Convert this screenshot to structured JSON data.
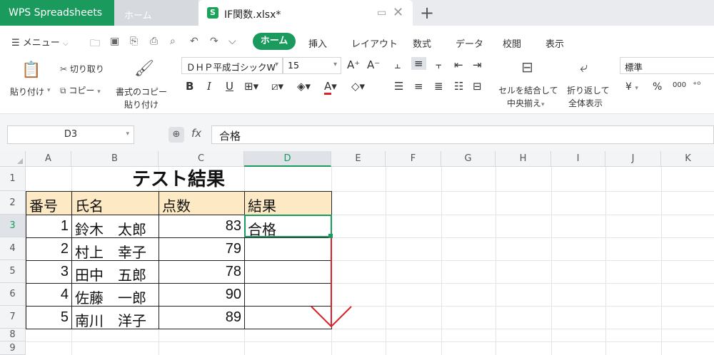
{
  "titlebar": {
    "app_tab": "WPS Spreadsheets",
    "home_tab": "ホーム",
    "file_tab": "IF関数.xlsx*",
    "file_icon": "S",
    "add_tab": "+"
  },
  "ribbon": {
    "menu_label": "メニュー",
    "tabs": [
      "ホーム",
      "挿入",
      "レイアウト",
      "数式",
      "データ",
      "校閲",
      "表示"
    ],
    "paste": "貼り付け",
    "cut": "切り取り",
    "copy": "コピー",
    "format_painter_line1": "書式のコピー",
    "format_painter_line2": "貼り付け",
    "font_name": "ＤＨＰ平成ゴシックW",
    "font_size": "15",
    "bold": "B",
    "italic": "I",
    "underline": "U",
    "merge_line1": "セルを結合して",
    "merge_line2": "中央揃え",
    "wrap_line1": "折り返して",
    "wrap_line2": "全体表示",
    "number_format": "標準",
    "currency": "¥",
    "percent": "%",
    "thousands": "000"
  },
  "formula_bar": {
    "name_box": "D3",
    "fx": "fx",
    "formula": "合格"
  },
  "sheet": {
    "columns": [
      "A",
      "B",
      "C",
      "D",
      "E",
      "F",
      "G",
      "H",
      "I",
      "J",
      "K"
    ],
    "rows": [
      "1",
      "2",
      "3",
      "4",
      "5",
      "6",
      "7",
      "8",
      "9"
    ],
    "title": "テスト結果",
    "headers": [
      "番号",
      "氏名",
      "点数",
      "結果"
    ],
    "records": [
      {
        "no": "1",
        "name": "鈴木　太郎",
        "score": "83",
        "result": "合格"
      },
      {
        "no": "2",
        "name": "村上　幸子",
        "score": "79",
        "result": ""
      },
      {
        "no": "3",
        "name": "田中　五郎",
        "score": "78",
        "result": ""
      },
      {
        "no": "4",
        "name": "佐藤　一郎",
        "score": "90",
        "result": ""
      },
      {
        "no": "5",
        "name": "南川　洋子",
        "score": "89",
        "result": ""
      }
    ]
  },
  "colors": {
    "accent": "#1a9a5c",
    "header_fill": "#fde9c4",
    "arrow": "#d9222a"
  }
}
